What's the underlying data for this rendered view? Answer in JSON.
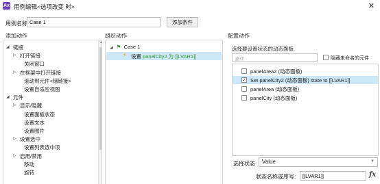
{
  "window": {
    "app_icon_text": "Ax",
    "title": "用例编辑<选项改变 时>",
    "close_glyph": "✕"
  },
  "case_name": {
    "label": "用例名称",
    "value": "Case 1",
    "add_condition_label": "添加条件"
  },
  "columns": {
    "add_action": "添加动作",
    "organize_action": "组织动作",
    "configure_action": "配置动作"
  },
  "action_tree": [
    {
      "label": "链接",
      "arrow": "◢",
      "level": 0
    },
    {
      "label": "打开链接",
      "arrow": "▷",
      "level": 1
    },
    {
      "label": "关闭窗口",
      "arrow": "",
      "level": 2
    },
    {
      "label": "在框架中打开链接",
      "arrow": "▷",
      "level": 1
    },
    {
      "label": "滚动到元件<锚链接>",
      "arrow": "",
      "level": 2
    },
    {
      "label": "设置自适应视图",
      "arrow": "",
      "level": 2
    },
    {
      "label": "元件",
      "arrow": "◢",
      "level": 0
    },
    {
      "label": "显示/隐藏",
      "arrow": "▷",
      "level": 1
    },
    {
      "label": "设置面板状态",
      "arrow": "",
      "level": 2
    },
    {
      "label": "设置文本",
      "arrow": "",
      "level": 2
    },
    {
      "label": "设置图片",
      "arrow": "",
      "level": 2
    },
    {
      "label": "设置选中",
      "arrow": "▷",
      "level": 1
    },
    {
      "label": "设置列表选中项",
      "arrow": "",
      "level": 2
    },
    {
      "label": "启用/禁用",
      "arrow": "▷",
      "level": 1
    },
    {
      "label": "移动",
      "arrow": "",
      "level": 2
    },
    {
      "label": "旋转",
      "arrow": "",
      "level": 2
    }
  ],
  "organize": {
    "case_arrow": "◢",
    "case_label": "Case 1",
    "action_label_prefix": "设置 ",
    "action_label_highlight": "panelCity2 为 [[LVAR1]]"
  },
  "configure": {
    "subheader": "选择要设置状态的动态面板",
    "filter_placeholder": "查找",
    "hide_unnamed_label": "隐藏未命名的元件",
    "panels": [
      {
        "label": "panelArea2 (动态面板)",
        "checked": false,
        "selected": false
      },
      {
        "label": "Set panelCity2 (动态面板) state to [[LVAR1]]",
        "checked": true,
        "selected": true
      },
      {
        "label": "panelArea (动态面板)",
        "checked": false,
        "selected": false
      },
      {
        "label": "panelCity (动态面板)",
        "checked": false,
        "selected": false
      }
    ],
    "state_label": "选择状态",
    "state_value": "Value",
    "value_label": "状态名称或序号:",
    "value_input": "[[LVAR1]]",
    "fx_label": "fx"
  },
  "colors": {
    "selection_bg": "#cde8f7",
    "link_green": "#2e9a2e",
    "app_icon": "#6a3fc1"
  }
}
